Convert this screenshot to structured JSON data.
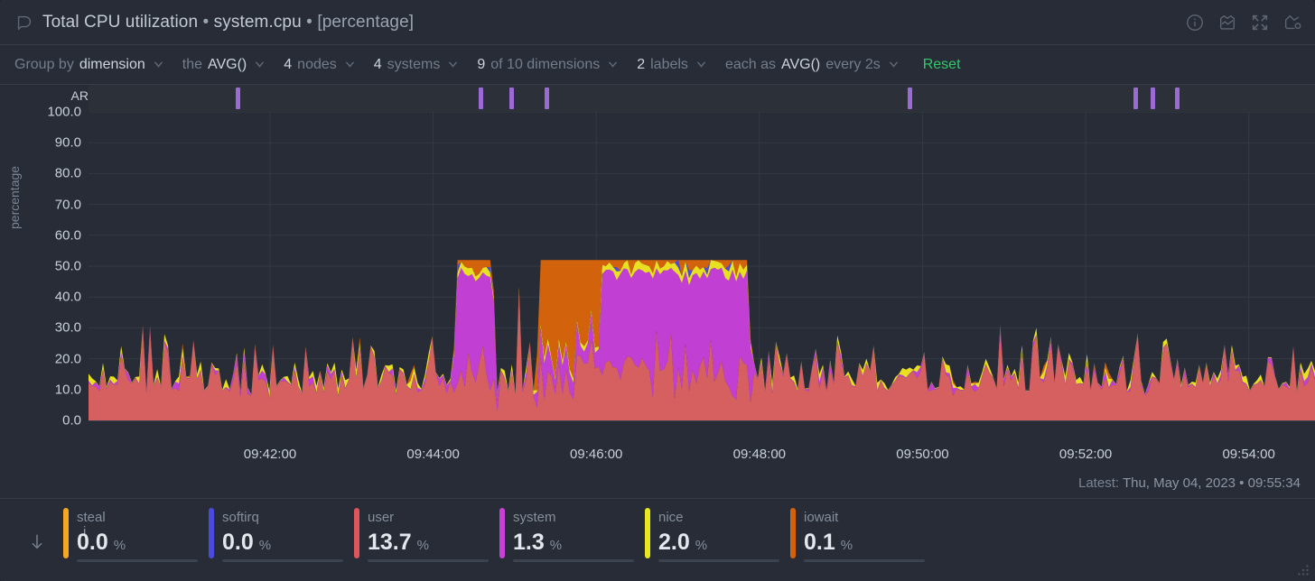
{
  "header": {
    "logo_icon": "netdata-logo-icon",
    "title_main": "Total CPU utilization",
    "sep1": "•",
    "context": "system.cpu",
    "sep2": "•",
    "units": "[percentage]",
    "icons": [
      {
        "name": "info-icon",
        "label": "Information"
      },
      {
        "name": "chart-type-icon",
        "label": "Chart type"
      },
      {
        "name": "fullscreen-icon",
        "label": "Fullscreen"
      },
      {
        "name": "anomaly-icon",
        "label": "Anomaly advisor"
      }
    ]
  },
  "toolbar": {
    "groups": [
      {
        "pre": "Group by",
        "value": "dimension",
        "post": "",
        "caret": true
      },
      {
        "pre": "the",
        "value": "AVG()",
        "post": "",
        "caret": true
      },
      {
        "pre": "",
        "value": "4",
        "post": "nodes",
        "caret": true
      },
      {
        "pre": "",
        "value": "4",
        "post": "systems",
        "caret": true
      },
      {
        "pre": "",
        "value": "9",
        "post": "of 10 dimensions",
        "caret": true
      },
      {
        "pre": "",
        "value": "2",
        "post": "labels",
        "caret": true
      },
      {
        "pre": "each as",
        "value": "AVG()",
        "post": "every 2s",
        "caret": true
      }
    ],
    "reset_label": "Reset",
    "reset_color": "#30c96b"
  },
  "chart_data": {
    "type": "area",
    "stacked": true,
    "title": "Total CPU utilization",
    "xlabel": "",
    "ylabel": "percentage",
    "ylim": [
      0,
      100
    ],
    "yticks": [
      "100.0",
      "90.0",
      "80.0",
      "70.0",
      "60.0",
      "50.0",
      "40.0",
      "30.0",
      "20.0",
      "10.0",
      "0.0"
    ],
    "ytick_values": [
      100,
      90,
      80,
      70,
      60,
      50,
      40,
      30,
      20,
      10,
      0
    ],
    "xticks": [
      "09:42:00",
      "09:44:00",
      "09:46:00",
      "09:48:00",
      "09:50:00",
      "09:52:00",
      "09:54:00"
    ],
    "xtick_positions_pct": [
      14.8,
      28.1,
      41.4,
      54.7,
      68.0,
      81.3,
      94.6
    ],
    "grid": true,
    "legend_position": "bottom",
    "anomaly_ribbon": {
      "label": "AR",
      "color": "#9b6ad4",
      "marks_pct": [
        12.0,
        31.8,
        34.3,
        37.2,
        66.8,
        85.2,
        86.6,
        88.6
      ]
    },
    "series": [
      {
        "name": "user",
        "color": "#d65f5f",
        "value": 13.7,
        "unit": "%"
      },
      {
        "name": "system",
        "color": "#c23fd4",
        "value": 1.3,
        "unit": "%"
      },
      {
        "name": "nice",
        "color": "#e8e020",
        "value": 2.0,
        "unit": "%"
      },
      {
        "name": "iowait",
        "color": "#d2620c",
        "value": 0.1,
        "unit": "%"
      },
      {
        "name": "softirq",
        "color": "#4a4ae0",
        "value": 0.0,
        "unit": "%"
      },
      {
        "name": "steal",
        "color": "#f5a623",
        "value": 0.0,
        "unit": "%"
      }
    ],
    "plateaus": [
      {
        "start_pct": 29.6,
        "end_pct": 33.4,
        "top": 52,
        "dominant": "system"
      },
      {
        "start_pct": 36.4,
        "end_pct": 54.2,
        "top": 52,
        "dominant": "system"
      }
    ],
    "baseline_band": {
      "series": "user",
      "typical_range": [
        8,
        30
      ]
    }
  },
  "footer": {
    "latest_label": "Latest:",
    "latest_value": "Thu, May 04, 2023 • 09:55:34",
    "scroll_icon": "down-arrow-icon"
  },
  "legend": [
    {
      "name": "steal",
      "value": "0.0",
      "unit": "%",
      "color": "#f5a623"
    },
    {
      "name": "softirq",
      "value": "0.0",
      "unit": "%",
      "color": "#4a4ae0"
    },
    {
      "name": "user",
      "value": "13.7",
      "unit": "%",
      "color": "#e0555b"
    },
    {
      "name": "system",
      "value": "1.3",
      "unit": "%",
      "color": "#c840d8"
    },
    {
      "name": "nice",
      "value": "2.0",
      "unit": "%",
      "color": "#e8e81f"
    },
    {
      "name": "iowait",
      "value": "0.1",
      "unit": "%",
      "color": "#d2620c"
    }
  ],
  "axis_info_icon": "i"
}
